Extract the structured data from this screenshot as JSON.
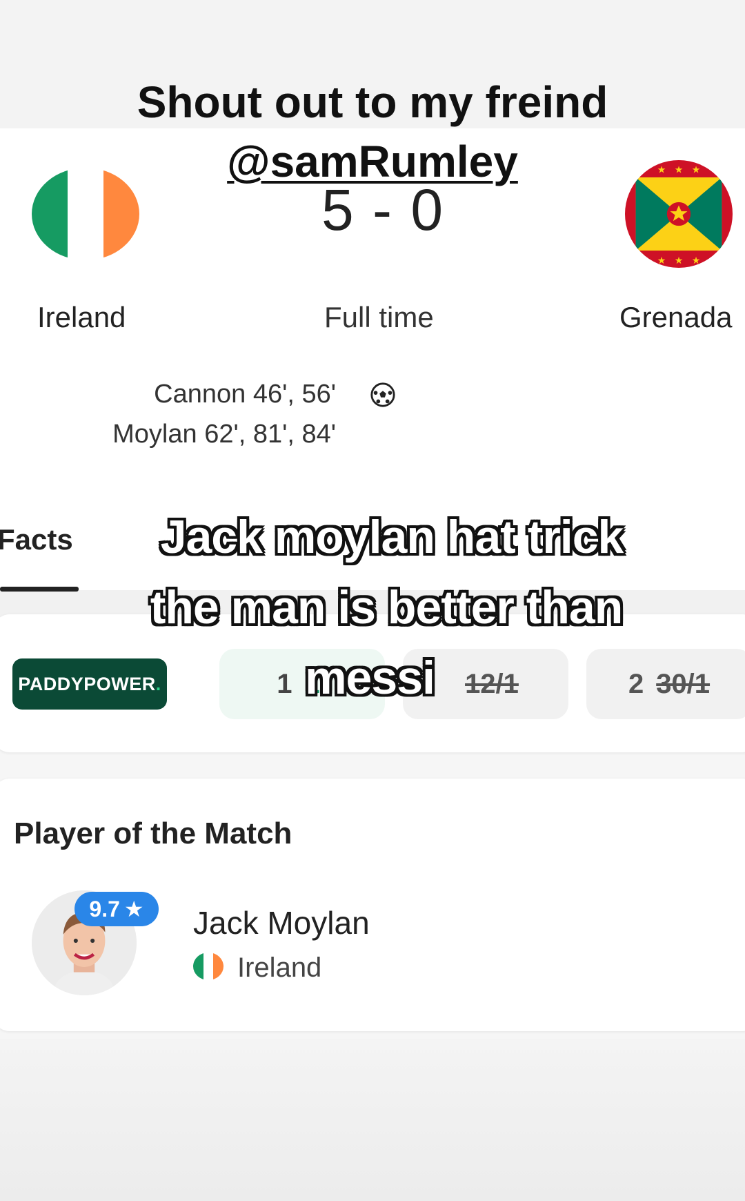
{
  "overlay": {
    "title_line1": "Shout out to my freind",
    "title_line2": "@samRumley",
    "caption_line1": "Jack moylan hat trick",
    "caption_line2": "the man is better than",
    "caption_line3": "messi"
  },
  "match": {
    "home_team": "Ireland",
    "away_team": "Grenada",
    "score": "5 - 0",
    "status": "Full time",
    "home_flag_icon": "ireland-flag-icon",
    "away_flag_icon": "grenada-flag-icon",
    "goal_icon": "soccer-ball-icon",
    "scorers": [
      "Cannon 46', 56'",
      "Moylan 62', 81', 84'"
    ]
  },
  "tabs": {
    "active": "Facts"
  },
  "odds": {
    "bookmaker": "PADDYPOWER",
    "home": {
      "label": "1",
      "price": "1/"
    },
    "draw": {
      "label": "",
      "price": "12/1"
    },
    "away": {
      "label": "2",
      "price": "30/1"
    }
  },
  "player_of_match": {
    "title": "Player of the Match",
    "rating": "9.7",
    "rating_icon": "star-icon",
    "name": "Jack Moylan",
    "country": "Ireland"
  },
  "colors": {
    "ireland_green": "#169b62",
    "ireland_orange": "#ff883e",
    "paddypower_green": "#0b4a36",
    "rating_blue": "#2a86e8",
    "odds_green": "#1a9a6a"
  }
}
